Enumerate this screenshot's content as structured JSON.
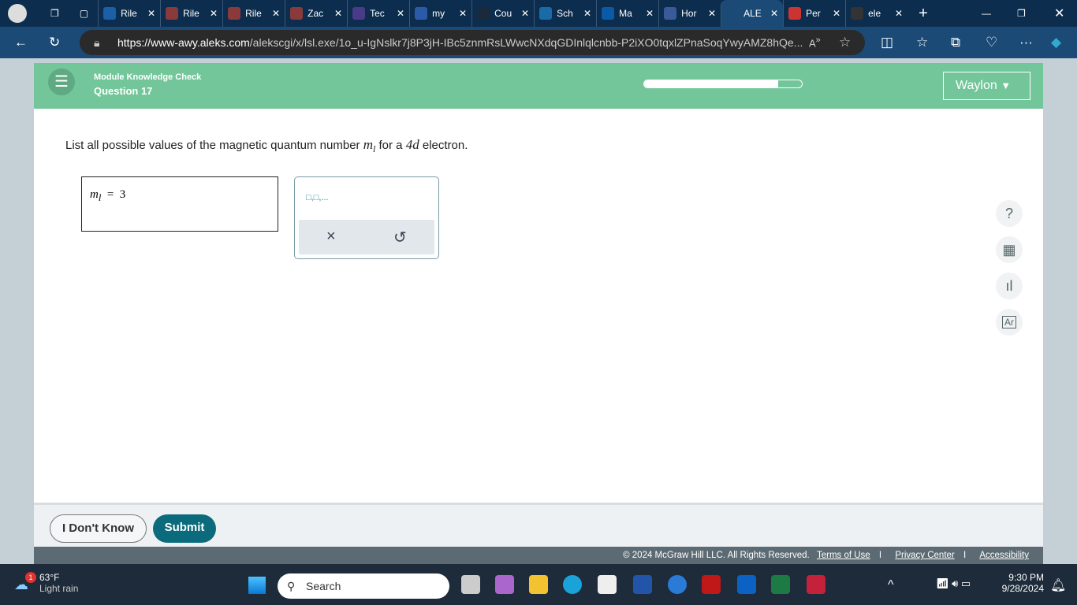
{
  "browser": {
    "tabs": [
      "Rile",
      "Rile",
      "Rile",
      "Zac",
      "Tec",
      "my",
      "Cou",
      "Sch",
      "Ma",
      "Hor",
      "ALE",
      "Per",
      "ele"
    ],
    "active_tab": 10,
    "url_host": "https://www-awy.aleks.com",
    "url_path": "/alekscgi/x/lsl.exe/1o_u-IgNslkr7j8P3jH-IBc5znmRsLWwcNXdqGDInlqlcnbb-P2iXO0tqxlZPnaSoqYwyAMZ8hQe..."
  },
  "header": {
    "module": "Module Knowledge Check",
    "question": "Question 17",
    "progress": 0.85,
    "user": "Waylon"
  },
  "question": {
    "prefix": "List all possible values of the magnetic quantum number ",
    "var": "m",
    "sub": "l",
    "mid": " for a ",
    "orbital": "4d",
    "suffix": " electron."
  },
  "answer": {
    "var": "m",
    "sub": "l",
    "eq": "=",
    "value": "3"
  },
  "palette": {
    "template": "□,□,...",
    "clear": "×",
    "undo": "↺"
  },
  "side_tools": [
    "?",
    "calculator",
    "chart",
    "Ar"
  ],
  "footer": {
    "dont_know": "I Don't Know",
    "submit": "Submit",
    "copyright": "© 2024 McGraw Hill LLC. All Rights Reserved.",
    "terms": "Terms of Use",
    "privacy": "Privacy Center",
    "accessibility": "Accessibility",
    "sep": "I"
  },
  "taskbar": {
    "weather_temp": "63°F",
    "weather_desc": "Light rain",
    "badge": "1",
    "search": "Search",
    "time": "9:30 PM",
    "date": "9/28/2024"
  }
}
